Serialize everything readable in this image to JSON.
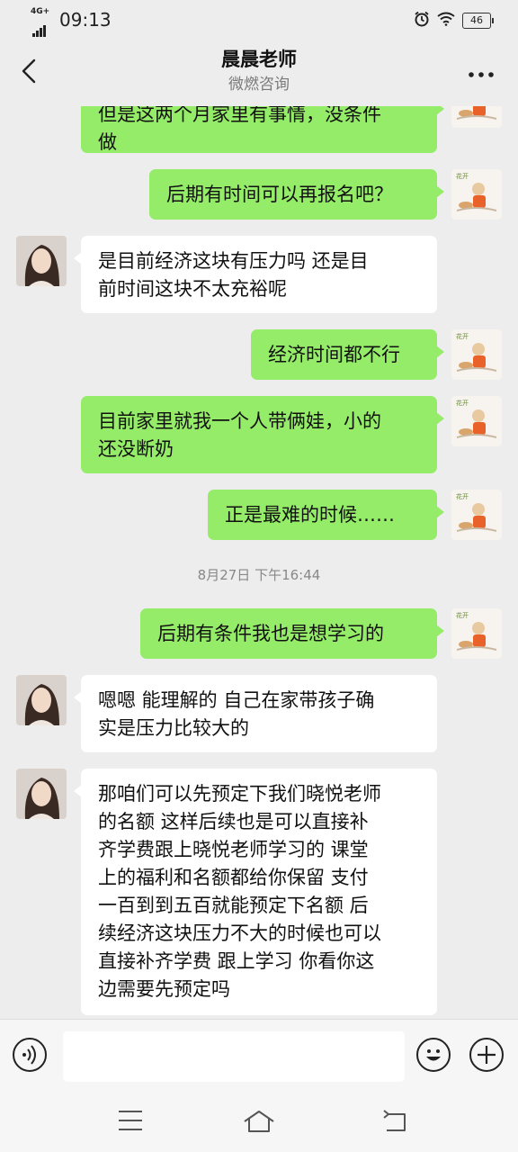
{
  "status_bar": {
    "network": "4G+",
    "time": "09:13",
    "battery": "46"
  },
  "header": {
    "title": "晨晨老师",
    "subtitle": "微燃咨询"
  },
  "messages": [
    {
      "side": "out",
      "lines": [
        "但是这两个月家里有事情，没条件",
        "做"
      ]
    },
    {
      "side": "out",
      "lines": [
        "后期有时间可以再报名吧？"
      ]
    },
    {
      "side": "in",
      "lines": [
        "是目前经济这块有压力吗 还是目",
        "前时间这块不太充裕呢"
      ]
    },
    {
      "side": "out",
      "lines": [
        "经济时间都不行"
      ]
    },
    {
      "side": "out",
      "lines": [
        "目前家里就我一个人带俩娃，小的",
        "还没断奶"
      ]
    },
    {
      "side": "out",
      "lines": [
        "正是最难的时候……"
      ]
    },
    {
      "side": "out",
      "lines": [
        "后期有条件我也是想学习的"
      ]
    },
    {
      "side": "in",
      "lines": [
        "嗯嗯 能理解的 自己在家带孩子确",
        "实是压力比较大的"
      ]
    },
    {
      "side": "in",
      "lines": [
        "那咱们可以先预定下我们晓悦老师",
        "的名额 这样后续也是可以直接补",
        "齐学费跟上晓悦老师学习的 课堂",
        "上的福利和名额都给你保留 支付",
        "一百到到五百就能预定下名额 后",
        "续经济这块压力不大的时候也可以",
        "直接补齐学费 跟上学习 你看你这",
        "边需要先预定吗"
      ]
    }
  ],
  "timestamp": "8月27日 下午16:44",
  "input": {
    "placeholder": "",
    "value": ""
  },
  "colors": {
    "outgoing_bubble": "#95ec69",
    "incoming_bubble": "#ffffff",
    "background": "#ededed"
  }
}
